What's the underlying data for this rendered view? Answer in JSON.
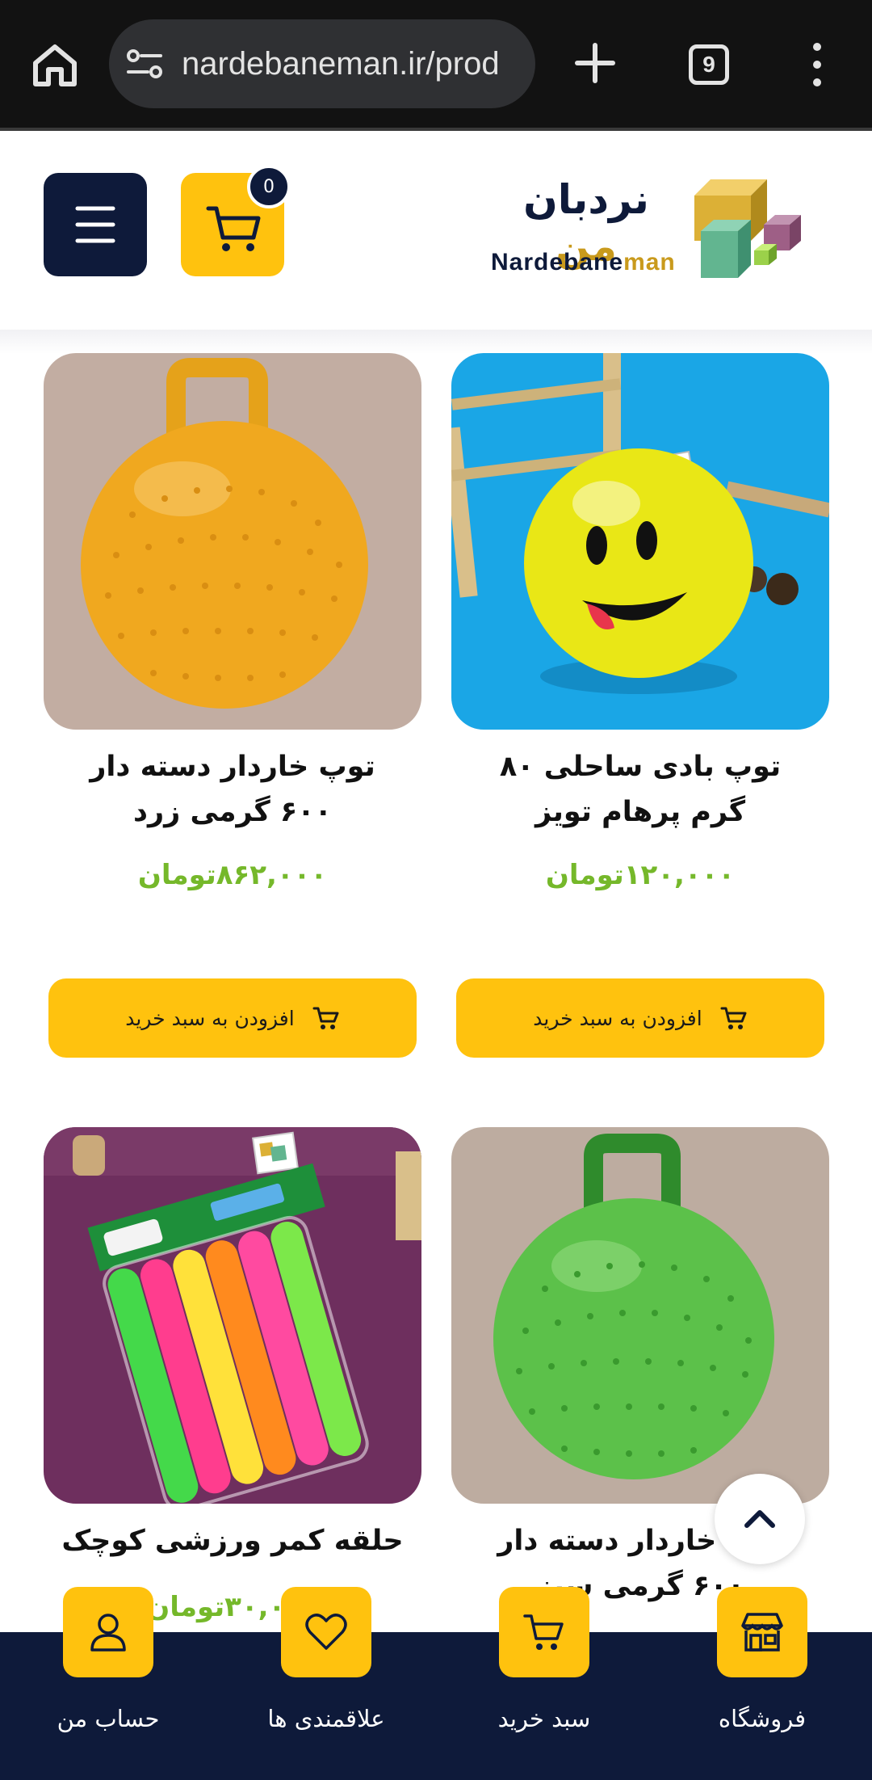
{
  "browser": {
    "url": "nardebaneman.ir/prod",
    "tab_count": "9"
  },
  "header": {
    "logo_fa_main": "نردبان",
    "logo_fa_accent": "من",
    "logo_en_main": "Nardebane",
    "logo_en_accent": "man",
    "cart_count": "0"
  },
  "products": [
    {
      "title": "توپ بادی ساحلی ۸۰ گرم پرهام تویز",
      "price": "۱۲۰,۰۰۰تومان",
      "button_label": "افزودن به سبد خرید"
    },
    {
      "title": "توپ خاردار دسته دار ۶۰۰ گرمی زرد",
      "price": "۸۶۲,۰۰۰تومان",
      "button_label": "افزودن به سبد خرید"
    },
    {
      "title": "توپ خاردار دسته دار ۶۰۰ گرمی سبز",
      "price": "",
      "button_label": ""
    },
    {
      "title": "حلقه کمر ورزشی کوچک",
      "price": "۳۰,۰۰۰تومان",
      "button_label": ""
    }
  ],
  "bottom_nav": {
    "shop": "فروشگاه",
    "cart": "سبد خرید",
    "wishlist": "علاقمندی ها",
    "account": "حساب من"
  },
  "colors": {
    "navy": "#0e1a3a",
    "yellow": "#ffc20e",
    "price_green": "#75b82a"
  },
  "icons": [
    "home-icon",
    "site-info-icon",
    "plus-icon",
    "tabs-icon",
    "more-vert-icon",
    "hamburger-icon",
    "cart-icon",
    "chevron-up-icon",
    "store-icon",
    "heart-icon",
    "user-icon"
  ]
}
